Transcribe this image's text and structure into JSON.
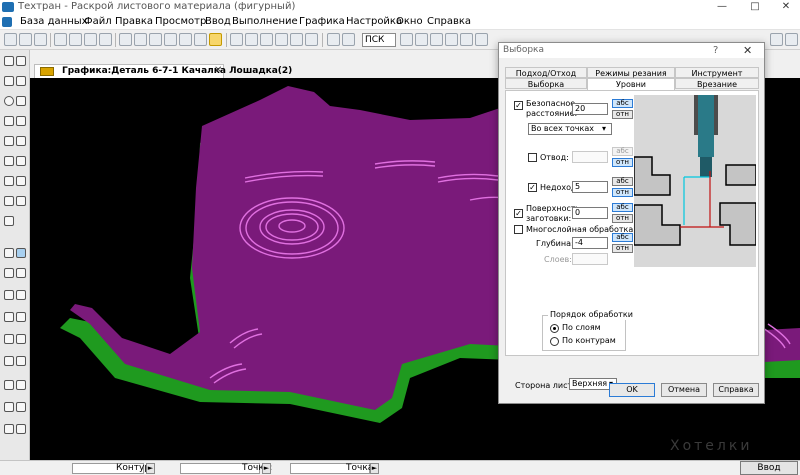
{
  "app": {
    "title": "Техтран - Раскрой листового материала (фигурный)"
  },
  "window_controls": {
    "minimize": "—",
    "maximize": "□",
    "close": "✕"
  },
  "menu": {
    "items": [
      "База данных",
      "Файл",
      "Правка",
      "Просмотр",
      "Ввод",
      "Выполнение",
      "Графика",
      "Настройка",
      "Окно",
      "Справка"
    ]
  },
  "toolbar": {
    "coord_system_value": "ПСК"
  },
  "document": {
    "tab_label": "Графика:Деталь 6-7-1 Качалка Лошадка(2)",
    "close": "✕"
  },
  "dialog": {
    "title": "Выборка",
    "help_glyph": "?",
    "close_glyph": "✕",
    "tabs_row1": [
      "Подход/Отход",
      "Режимы резания",
      "Инструмент"
    ],
    "tabs_row2": [
      "Выборка",
      "Уровни",
      "Врезание"
    ],
    "active_tab": "Уровни",
    "safe_distance": {
      "label": "Безопасное расстояние:",
      "value": "20",
      "checked": true,
      "abs": "абс",
      "rel": "отн"
    },
    "safe_mode": {
      "value": "Во всех точках"
    },
    "retract": {
      "label": "Отвод:",
      "value": "",
      "checked": false,
      "abs": "абс",
      "rel": "отн"
    },
    "underpass": {
      "label": "Недоход:",
      "value": "5",
      "checked": true,
      "abs": "абс",
      "rel": "отн"
    },
    "stock_surface": {
      "label": "Поверхность заготовки:",
      "value": "0",
      "checked": true,
      "abs": "абс",
      "rel": "отн"
    },
    "multilayer": {
      "label": "Многослойная обработка",
      "checked": false
    },
    "depth": {
      "label": "Глубина:",
      "value": "-4",
      "abs": "абс",
      "rel": "отн"
    },
    "layers": {
      "label": "Слоев:",
      "value": ""
    },
    "processing_order": {
      "title": "Порядок обработки",
      "options": [
        "По слоям",
        "По контурам"
      ],
      "selected": "По слоям"
    },
    "sheet_side": {
      "label": "Сторона листа:",
      "value": "Верхняя"
    },
    "buttons": {
      "ok": "OK",
      "cancel": "Отмена",
      "help": "Справка"
    }
  },
  "statusbar": {
    "contour_label": "Контур:",
    "point1_label": "Точка:",
    "point2_label": "Точка:",
    "enter_button": "Ввод"
  },
  "colors": {
    "part_top": "#7a1a7a",
    "part_side": "#1f9a1f",
    "outline": "#e070e0",
    "viewport_bg": "#000000"
  },
  "watermark_text": "Хотелки"
}
